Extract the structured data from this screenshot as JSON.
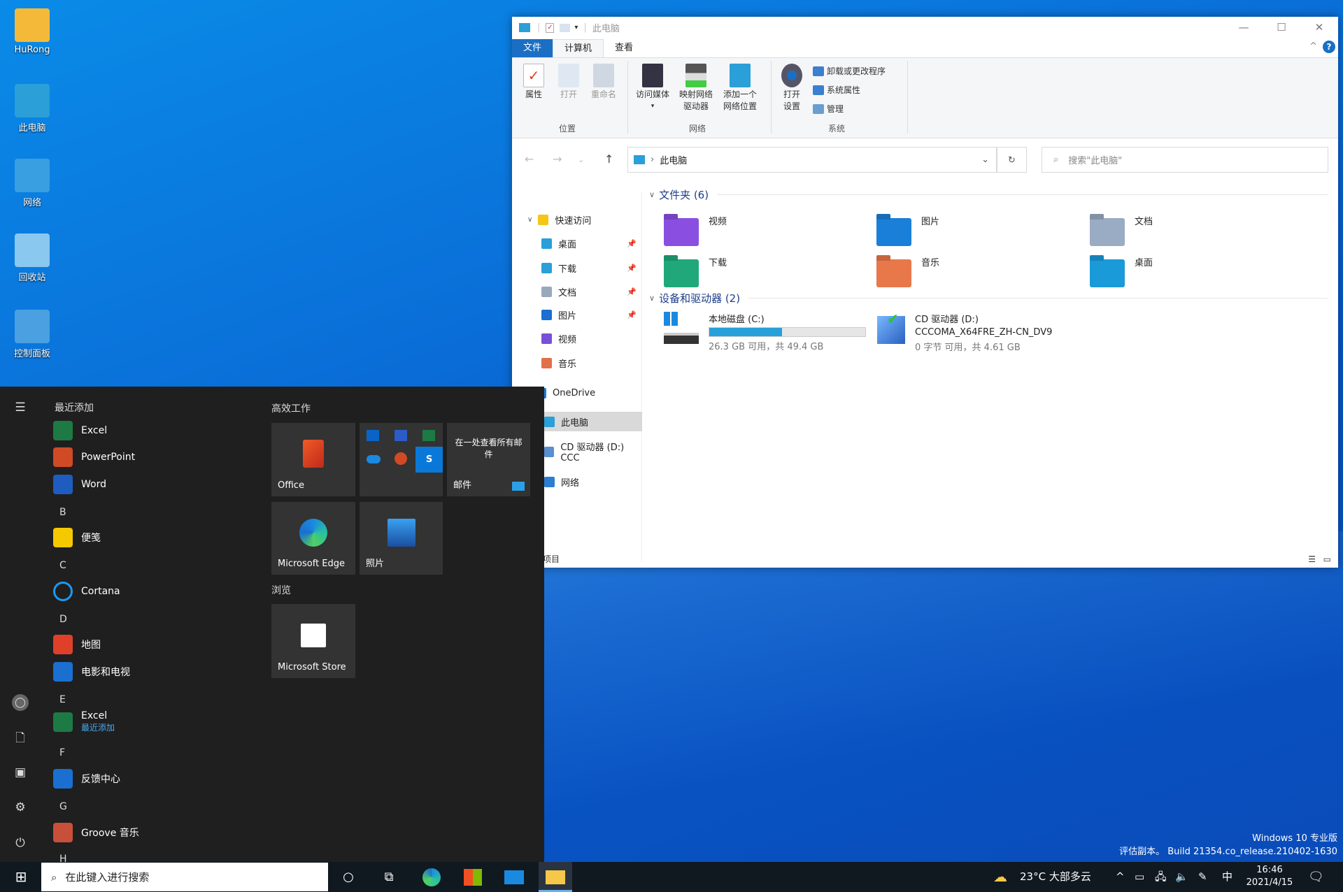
{
  "desktop": {
    "icons": [
      {
        "label": "HuRong",
        "icon": "user-folder-icon"
      },
      {
        "label": "此电脑",
        "icon": "computer-icon"
      },
      {
        "label": "网络",
        "icon": "network-icon"
      },
      {
        "label": "回收站",
        "icon": "recycle-bin-icon"
      },
      {
        "label": "控制面板",
        "icon": "control-panel-icon"
      }
    ],
    "watermark": {
      "line1": "Windows 10 专业版",
      "line2": "评估副本。 Build 21354.co_release.210402-1630"
    }
  },
  "explorer": {
    "title": "此电脑",
    "window_buttons": {
      "minimize": "—",
      "maximize": "☐",
      "close": "✕"
    },
    "tabs": [
      "文件",
      "计算机",
      "查看"
    ],
    "ribbon": {
      "groups": [
        {
          "label": "位置",
          "buttons": [
            "属性",
            "打开",
            "重命名"
          ]
        },
        {
          "label": "网络",
          "buttons": [
            "访问媒体",
            "映射网络\n驱动器",
            "添加一个\n网络位置"
          ]
        },
        {
          "label": "系统",
          "buttons": [
            "打开\n设置"
          ],
          "small": [
            "卸载或更改程序",
            "系统属性",
            "管理"
          ]
        }
      ]
    },
    "address": {
      "path": "此电脑",
      "search_placeholder": "搜索\"此电脑\""
    },
    "nav": [
      {
        "label": "快速访问",
        "color": "#f5c518"
      },
      {
        "label": "桌面",
        "color": "#2a9fd8",
        "pinned": true
      },
      {
        "label": "下载",
        "color": "#2a9fd8",
        "pinned": true
      },
      {
        "label": "文档",
        "color": "#9aa8bb",
        "pinned": true
      },
      {
        "label": "图片",
        "color": "#1a6fd0",
        "pinned": true
      },
      {
        "label": "视频",
        "color": "#7a4fd8"
      },
      {
        "label": "音乐",
        "color": "#e0704a"
      },
      {
        "label": "OneDrive",
        "color": "#1a7fd8"
      },
      {
        "label": "此电脑",
        "color": "#2a9fd8",
        "selected": true
      },
      {
        "label": "CD 驱动器 (D:) CCC",
        "color": "#5a8fd0"
      },
      {
        "label": "网络",
        "color": "#2a7fd0"
      }
    ],
    "folders_header": "文件夹 (6)",
    "folders": [
      {
        "label": "视频",
        "color": "#8a4fe0"
      },
      {
        "label": "图片",
        "color": "#1a7fd8"
      },
      {
        "label": "文档",
        "color": "#9aabc4"
      },
      {
        "label": "下载",
        "color": "#20a87a"
      },
      {
        "label": "音乐",
        "color": "#e8784a"
      },
      {
        "label": "桌面",
        "color": "#1a9ad8"
      }
    ],
    "devices_header": "设备和驱动器 (2)",
    "drives": [
      {
        "name": "本地磁盘 (C:)",
        "free": "26.3 GB 可用，共 49.4 GB",
        "used_percent": 46.8
      },
      {
        "name": "CD 驱动器 (D:)",
        "label": "CCCOMA_X64FRE_ZH-CN_DV9",
        "free": "0 字节 可用，共 4.61 GB"
      }
    ],
    "status": "项目"
  },
  "start": {
    "recent_header": "最近添加",
    "apps": [
      {
        "label": "Excel",
        "color": "#1d7a45"
      },
      {
        "label": "PowerPoint",
        "color": "#d04a26"
      },
      {
        "label": "Word",
        "color": "#1f5cc0"
      },
      {
        "letter": "B"
      },
      {
        "label": "便笺",
        "color": "#f6c800"
      },
      {
        "letter": "C"
      },
      {
        "label": "Cortana",
        "color": "#1f1f1f",
        "ring": true
      },
      {
        "letter": "D"
      },
      {
        "label": "地图",
        "color": "#e0402a"
      },
      {
        "label": "电影和电视",
        "color": "#1a6fd0"
      },
      {
        "letter": "E"
      },
      {
        "label": "Excel",
        "sub": "最近添加",
        "color": "#1d7a45"
      },
      {
        "letter": "F"
      },
      {
        "label": "反馈中心",
        "color": "#1a6fd0"
      },
      {
        "letter": "G"
      },
      {
        "label": "Groove 音乐",
        "color": "#c8503a"
      },
      {
        "letter": "H"
      }
    ],
    "groups": {
      "productivity": "高效工作",
      "browse": "浏览"
    },
    "tiles": {
      "office": "Office",
      "mail_text": "在一处查看所有邮件",
      "mail": "邮件",
      "edge": "Microsoft Edge",
      "photos": "照片",
      "store": "Microsoft Store"
    }
  },
  "taskbar": {
    "search_placeholder": "在此键入进行搜索",
    "weather": "23°C  大部多云",
    "ime": "中",
    "time": "16:46",
    "date": "2021/4/15"
  }
}
